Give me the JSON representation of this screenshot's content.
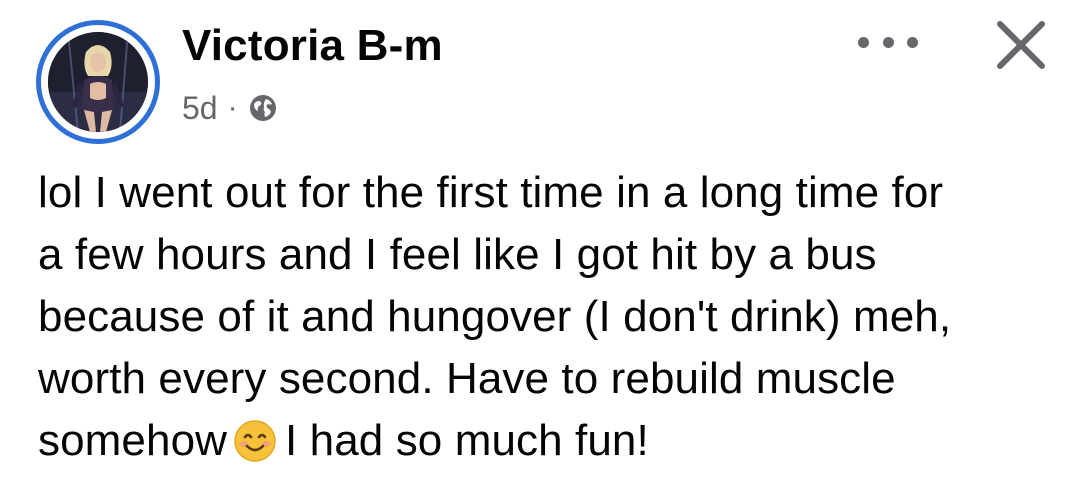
{
  "post": {
    "author_name": "Victoria B-m",
    "timestamp": "5d",
    "separator": "·",
    "privacy_icon": "globe-icon",
    "more_icon": "more-options-icon",
    "close_icon": "close-icon",
    "text_lines": [
      "lol I went out for the first time in a long time for",
      "a few hours and I feel like I got hit by a bus",
      "because of it and hungover (I don't drink) meh,",
      "worth every second. Have to rebuild muscle"
    ],
    "last_line_before_emoji": "somehow",
    "emoji_icon": "smiling-face-emoji-icon",
    "last_line_after_emoji": "I had so much fun!"
  },
  "colors": {
    "avatar_ring": "#2f6fd8",
    "text": "#050505",
    "secondary_text": "#65676b",
    "emoji_yellow": "#f7c23a"
  }
}
